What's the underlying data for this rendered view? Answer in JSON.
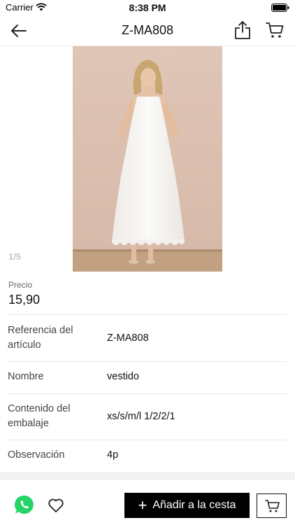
{
  "status_bar": {
    "carrier": "Carrier",
    "time": "8:38 PM"
  },
  "nav": {
    "title": "Z-MA808"
  },
  "gallery": {
    "page_indicator": "1/5"
  },
  "price": {
    "label": "Precio",
    "value": "15,90"
  },
  "details": [
    {
      "label": "Referencia del artículo",
      "value": "Z-MA808"
    },
    {
      "label": "Nombre",
      "value": "vestido"
    },
    {
      "label": "Contenido del embalaje",
      "value": "xs/s/m/l 1/2/2/1"
    },
    {
      "label": "Observación",
      "value": "4p"
    }
  ],
  "bottom_bar": {
    "add_to_cart_label": "Añadir a la cesta"
  },
  "colors": {
    "whatsapp": "#25D366",
    "button_bg": "#000000",
    "background": "#ffffff"
  },
  "icons": [
    "wifi-icon",
    "battery-icon",
    "back-arrow-icon",
    "share-icon",
    "cart-icon",
    "whatsapp-icon",
    "heart-icon",
    "plus-icon"
  ]
}
